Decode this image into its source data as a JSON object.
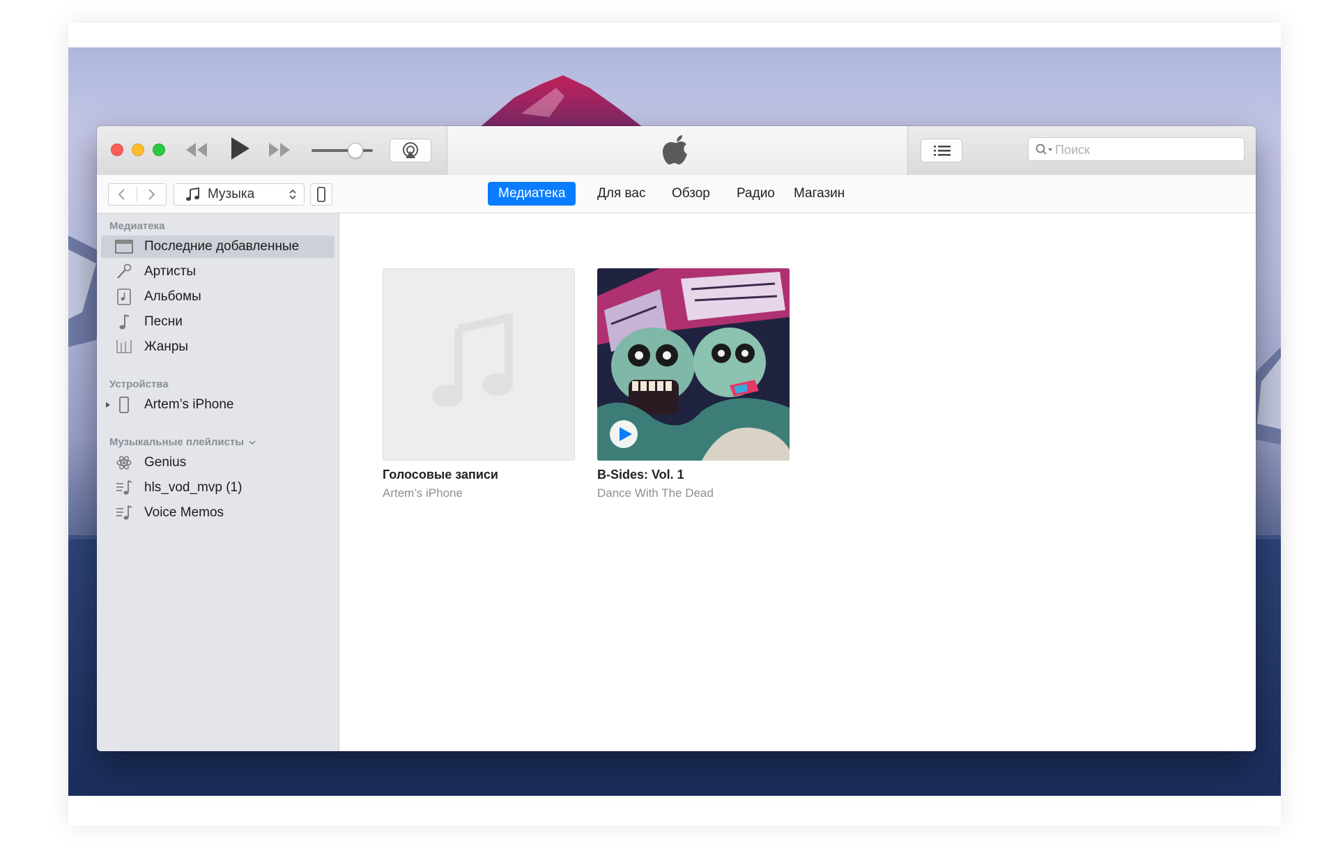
{
  "toolbar": {
    "search_placeholder": "Поиск",
    "media_kind": "Музыка"
  },
  "nav_tabs": [
    {
      "label": "Медиатека",
      "active": true
    },
    {
      "label": "Для вас",
      "active": false
    },
    {
      "label": "Обзор",
      "active": false
    },
    {
      "label": "Радио",
      "active": false
    },
    {
      "label": "Магазин",
      "active": false
    }
  ],
  "sidebar": {
    "library_title": "Медиатека",
    "library_items": [
      {
        "label": "Последние добавленные",
        "icon": "recently-added-icon",
        "selected": true
      },
      {
        "label": "Артисты",
        "icon": "microphone-icon"
      },
      {
        "label": "Альбомы",
        "icon": "album-icon"
      },
      {
        "label": "Песни",
        "icon": "music-note-icon"
      },
      {
        "label": "Жанры",
        "icon": "genres-icon"
      }
    ],
    "devices_title": "Устройства",
    "devices": [
      {
        "label": "Artem’s iPhone",
        "icon": "iphone-icon"
      }
    ],
    "playlists_title": "Музыкальные плейлисты",
    "playlists": [
      {
        "label": "Genius",
        "icon": "genius-icon"
      },
      {
        "label": "hls_vod_mvp (1)",
        "icon": "playlist-icon"
      },
      {
        "label": "Voice Memos",
        "icon": "playlist-icon"
      }
    ]
  },
  "albums": [
    {
      "title": "Голосовые записи",
      "subtitle": "Artem’s iPhone",
      "artwork": "empty-placeholder"
    },
    {
      "title": "B-Sides: Vol. 1",
      "subtitle": "Dance With The Dead",
      "artwork": "zombie-illustration"
    }
  ],
  "annotation": {
    "color": "#e02a1d",
    "target": "device-button"
  },
  "colors": {
    "accent": "#0a7cff",
    "sidebar_bg": "#e3e5ea"
  }
}
